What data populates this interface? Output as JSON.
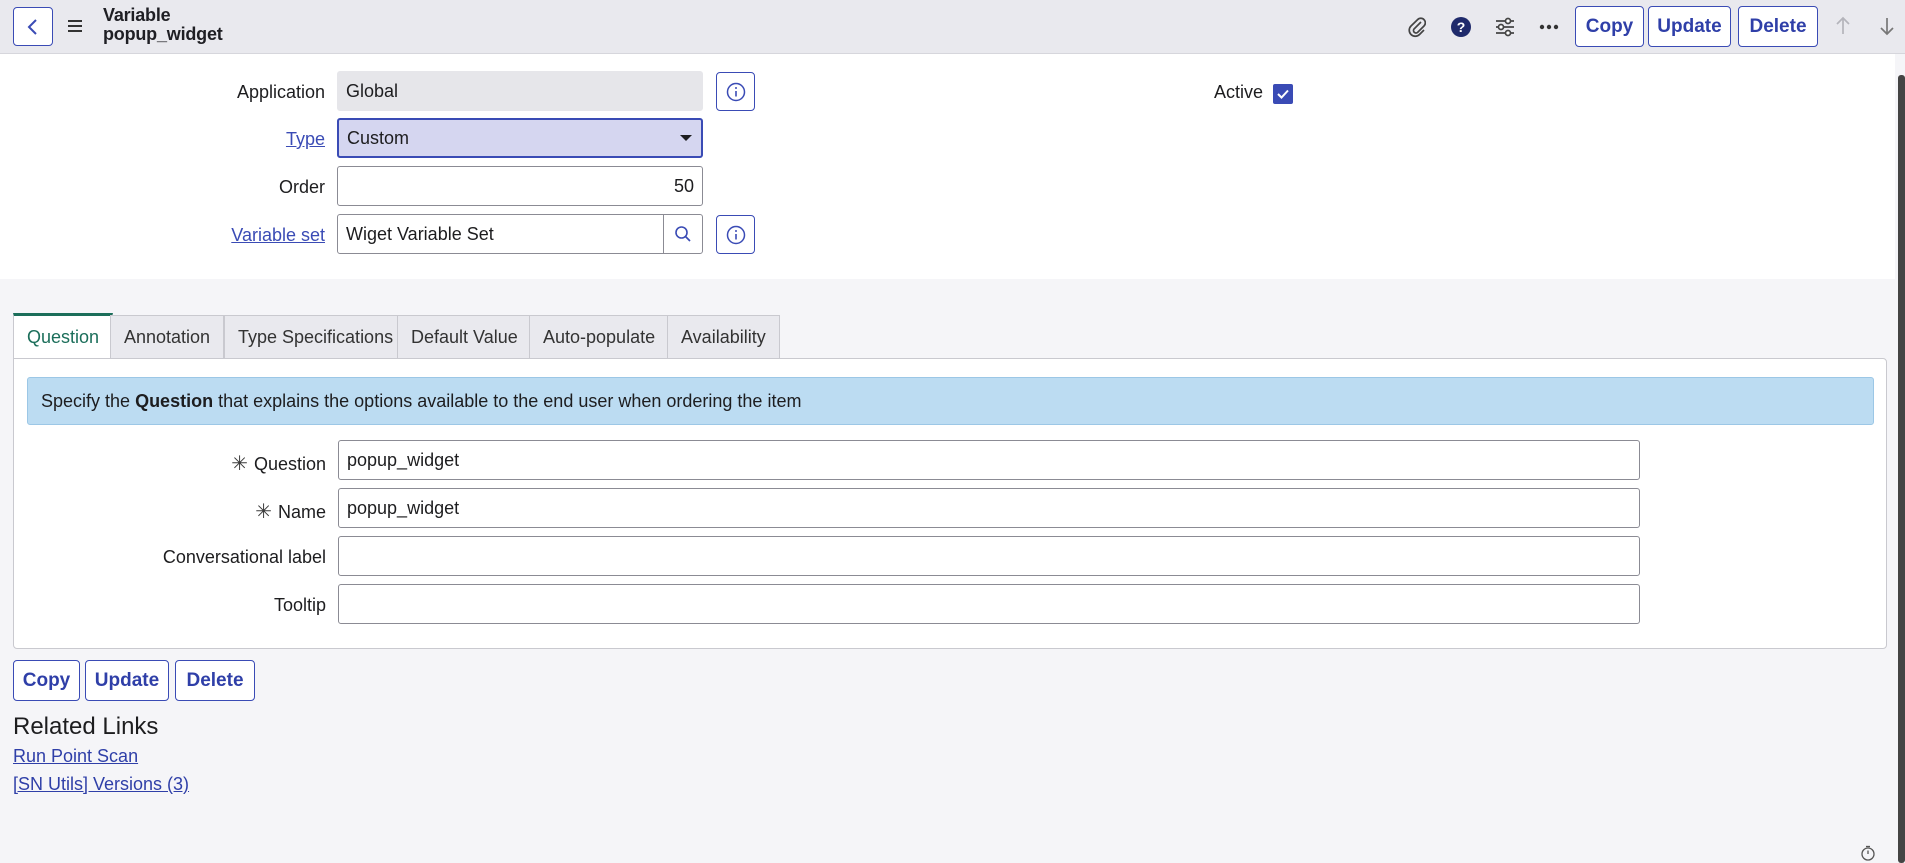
{
  "header": {
    "title_line1": "Variable",
    "title_line2": "popup_widget",
    "buttons": {
      "copy": "Copy",
      "update": "Update",
      "delete": "Delete"
    },
    "icons": [
      "paperclip-icon",
      "help-icon",
      "settings-sliders-icon",
      "more-icon",
      "arrow-up-icon",
      "arrow-down-icon"
    ]
  },
  "form": {
    "application": {
      "label": "Application",
      "value": "Global"
    },
    "type": {
      "label": "Type",
      "value": "Custom"
    },
    "order": {
      "label": "Order",
      "value": "50"
    },
    "variable_set": {
      "label": "Variable set",
      "value": "Wiget Variable Set"
    },
    "active": {
      "label": "Active",
      "checked": true
    }
  },
  "tabs": [
    {
      "label": "Question"
    },
    {
      "label": "Annotation"
    },
    {
      "label": "Type Specifications"
    },
    {
      "label": "Default Value"
    },
    {
      "label": "Auto-populate"
    },
    {
      "label": "Availability"
    }
  ],
  "question_panel": {
    "banner_prefix": "Specify the ",
    "banner_bold": "Question",
    "banner_suffix": " that explains the options available to the end user when ordering the item",
    "fields": {
      "question": {
        "label": "Question",
        "value": "popup_widget",
        "required": true
      },
      "name": {
        "label": "Name",
        "value": "popup_widget",
        "required": true
      },
      "conversational_label": {
        "label": "Conversational label",
        "value": ""
      },
      "tooltip": {
        "label": "Tooltip",
        "value": ""
      }
    }
  },
  "bottom_buttons": {
    "copy": "Copy",
    "update": "Update",
    "delete": "Delete"
  },
  "related_links": {
    "title": "Related Links",
    "links": [
      "Run Point Scan",
      "[SN Utils] Versions (3)"
    ]
  },
  "colors": {
    "accent": "#3a4bb5",
    "tab_active": "#1b6e5a",
    "banner": "#bcdcf2"
  }
}
